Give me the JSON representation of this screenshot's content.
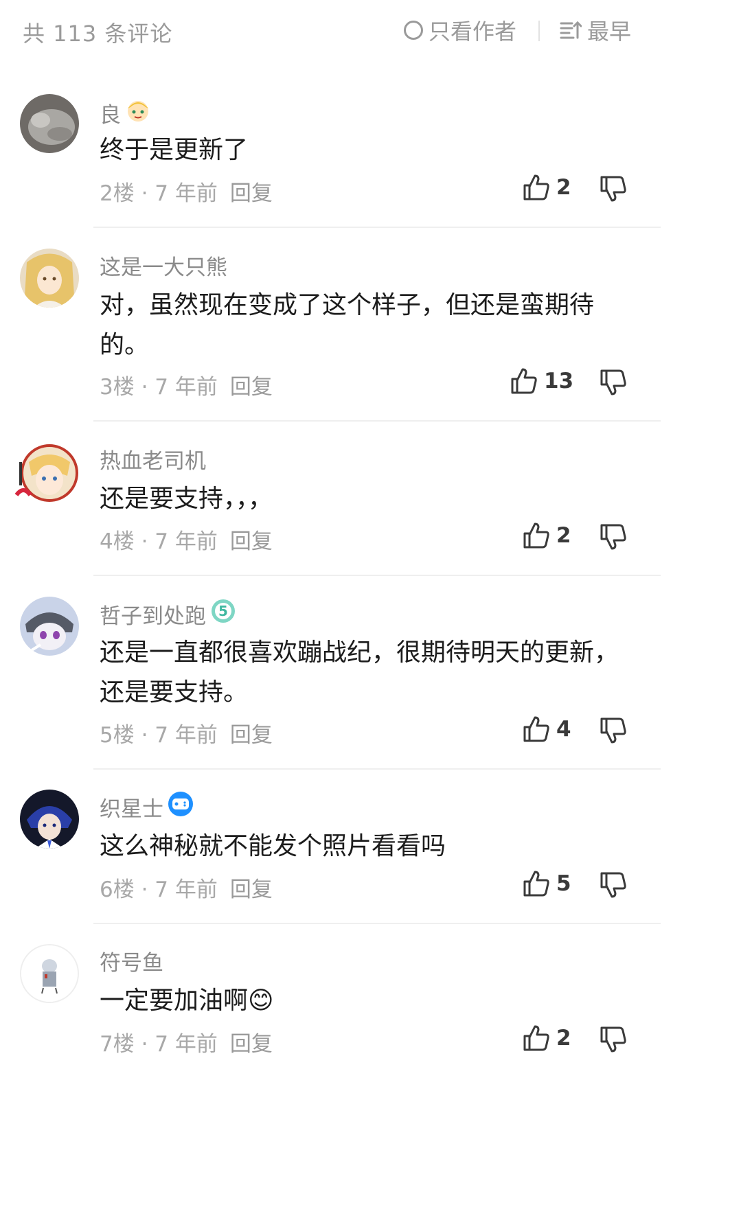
{
  "header": {
    "comment_count": "共 113 条评论",
    "author_only_label": "只看作者",
    "sort_label": "最早"
  },
  "comments": [
    {
      "user": "良",
      "text": "终于是更新了",
      "floor": "2楼 · 7 年前",
      "reply": "回复",
      "likes": "2"
    },
    {
      "user": "这是一大只熊",
      "text": "对，虽然现在变成了这个样子，但还是蛮期待的。",
      "floor": "3楼 · 7 年前",
      "reply": "回复",
      "likes": "13"
    },
    {
      "user": "热血老司机",
      "text": "还是要支持，，，",
      "floor": "4楼 · 7 年前",
      "reply": "回复",
      "likes": "2"
    },
    {
      "user": "哲子到处跑",
      "text": "还是一直都很喜欢蹦战纪，很期待明天的更新，还是要支持。",
      "floor": "5楼 · 7 年前",
      "reply": "回复",
      "likes": "4"
    },
    {
      "user": "织星士",
      "text": "这么神秘就不能发个照片看看吗",
      "floor": "6楼 · 7 年前",
      "reply": "回复",
      "likes": "5"
    },
    {
      "user": "符号鱼",
      "text": "一定要加油啊😊",
      "floor": "7楼 · 7 年前",
      "reply": "回复",
      "likes": "2"
    }
  ]
}
